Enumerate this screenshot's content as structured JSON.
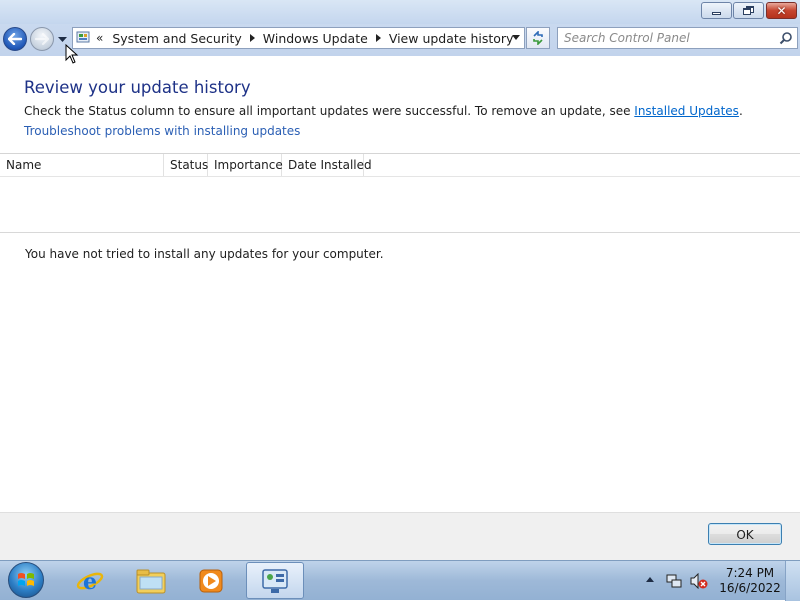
{
  "window": {
    "caption_buttons": [
      "minimize",
      "maximize",
      "close"
    ]
  },
  "navigation": {
    "back_icon": "back-arrow-icon",
    "forward_icon": "forward-arrow-icon",
    "address": {
      "chevron": "«",
      "crumbs": [
        "System and Security",
        "Windows Update",
        "View update history"
      ]
    },
    "search": {
      "placeholder": "Search Control Panel"
    }
  },
  "main": {
    "title": "Review your update history",
    "description_prefix": "Check the Status column to ensure all important updates were successful. To remove an update, see ",
    "installed_updates_link": "Installed Updates",
    "description_suffix": ".",
    "troubleshoot_link": "Troubleshoot problems with installing updates",
    "columns": [
      "Name",
      "Status",
      "Importance",
      "Date Installed"
    ],
    "empty_message": "You have not tried to install any updates for your computer."
  },
  "footer": {
    "ok_label": "OK"
  },
  "taskbar": {
    "pinned": [
      "internet-explorer-icon",
      "windows-explorer-icon",
      "media-player-icon",
      "control-panel-icon"
    ],
    "clock": {
      "time": "7:24 PM",
      "date": "16/6/2022"
    }
  },
  "colors": {
    "title": "#1e3287",
    "link": "#0066cc",
    "taskbar": "#9eb9d8"
  }
}
